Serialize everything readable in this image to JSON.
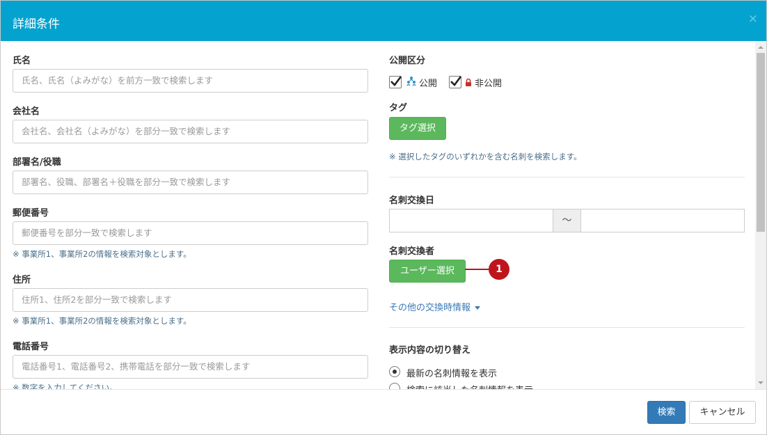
{
  "dialog": {
    "title": "詳細条件",
    "close": "×"
  },
  "left": {
    "name": {
      "label": "氏名",
      "placeholder": "氏名、氏名（よみがな）を前方一致で検索します"
    },
    "company": {
      "label": "会社名",
      "placeholder": "会社名、会社名（よみがな）を部分一致で検索します"
    },
    "dept": {
      "label": "部署名/役職",
      "placeholder": "部署名、役職、部署名＋役職を部分一致で検索します"
    },
    "postal": {
      "label": "郵便番号",
      "placeholder": "郵便番号を部分一致で検索します",
      "note": "※ 事業所1、事業所2の情報を検索対象とします。"
    },
    "address": {
      "label": "住所",
      "placeholder": "住所1、住所2を部分一致で検索します",
      "note": "※ 事業所1、事業所2の情報を検索対象とします。"
    },
    "phone": {
      "label": "電話番号",
      "placeholder": "電話番号1、電話番号2、携帯電話を部分一致で検索します",
      "note": "※ 数字を入力してください。"
    }
  },
  "right": {
    "visibility": {
      "label": "公開区分",
      "options": [
        {
          "label": "公開",
          "checked": true,
          "icon": "shared-people-icon"
        },
        {
          "label": "非公開",
          "checked": true,
          "icon": "lock-icon"
        }
      ]
    },
    "tag": {
      "label": "タグ",
      "button": "タグ選択",
      "note": "※ 選択したタグのいずれかを含む名刺を検索します。"
    },
    "exchange_date": {
      "label": "名刺交換日",
      "separator": "～",
      "from": "",
      "to": ""
    },
    "exchanger": {
      "label": "名刺交換者",
      "button": "ユーザー選択",
      "callout": "1"
    },
    "other_info_link": "その他の交換時情報",
    "display": {
      "label": "表示内容の切り替え",
      "options": [
        {
          "label": "最新の名刺情報を表示",
          "selected": true
        },
        {
          "label": "検索に該当した名刺情報を表示",
          "selected": false
        }
      ]
    }
  },
  "footer": {
    "search": "検索",
    "cancel": "キャンセル"
  },
  "colors": {
    "header": "#04a3cf",
    "green_button": "#5cb85c",
    "primary_button": "#337ab7",
    "callout": "#c0141c",
    "link": "#3a7ab8"
  }
}
